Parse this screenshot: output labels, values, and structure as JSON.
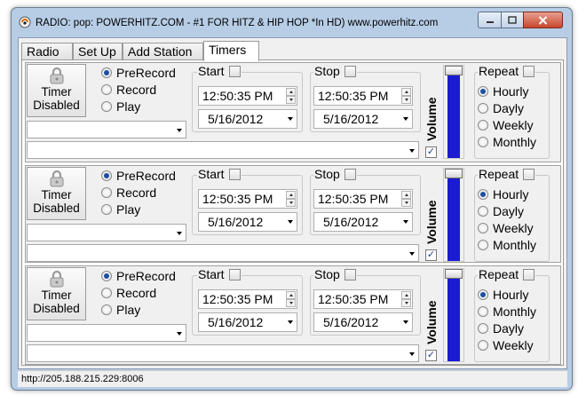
{
  "window": {
    "title": "RADIO: pop: POWERHITZ.COM - #1 FOR HITZ & HIP HOP *In HD) www.powerhitz.com",
    "app_icon": "radio-icon",
    "controls": [
      "minimize-icon",
      "maximize-icon",
      "close-icon"
    ]
  },
  "tabs": [
    {
      "label": "Radio",
      "active": false
    },
    {
      "label": "Set Up",
      "active": false
    },
    {
      "label": "Add Station",
      "active": false
    },
    {
      "label": "Timers",
      "active": true
    }
  ],
  "timers": [
    {
      "button": {
        "line1": "Timer",
        "line2": "Disabled",
        "icon": "lock-icon"
      },
      "modes": [
        "PreRecord",
        "Record",
        "Play"
      ],
      "selected_mode": "PreRecord",
      "start": {
        "label": "Start",
        "checked": false,
        "time": "12:50:35 PM",
        "date": "5/16/2012"
      },
      "stop": {
        "label": "Stop",
        "checked": false,
        "time": "12:50:35 PM",
        "date": "5/16/2012"
      },
      "volume": {
        "label": "Volume",
        "checked": true,
        "level": 0.95
      },
      "repeat": {
        "label": "Repeat",
        "checked": false,
        "options": [
          "Hourly",
          "Dayly",
          "Weekly",
          "Monthly"
        ],
        "selected": "Hourly"
      }
    },
    {
      "button": {
        "line1": "Timer",
        "line2": "Disabled",
        "icon": "lock-icon"
      },
      "modes": [
        "PreRecord",
        "Record",
        "Play"
      ],
      "selected_mode": "PreRecord",
      "start": {
        "label": "Start",
        "checked": false,
        "time": "12:50:35 PM",
        "date": "5/16/2012"
      },
      "stop": {
        "label": "Stop",
        "checked": false,
        "time": "12:50:35 PM",
        "date": "5/16/2012"
      },
      "volume": {
        "label": "Volume",
        "checked": true,
        "level": 0.95
      },
      "repeat": {
        "label": "Repeat",
        "checked": false,
        "options": [
          "Hourly",
          "Dayly",
          "Weekly",
          "Monthly"
        ],
        "selected": "Hourly"
      }
    },
    {
      "button": {
        "line1": "Timer",
        "line2": "Disabled",
        "icon": "lock-icon"
      },
      "modes": [
        "PreRecord",
        "Record",
        "Play"
      ],
      "selected_mode": "PreRecord",
      "start": {
        "label": "Start",
        "checked": false,
        "time": "12:50:35 PM",
        "date": "5/16/2012"
      },
      "stop": {
        "label": "Stop",
        "checked": false,
        "time": "12:50:35 PM",
        "date": "5/16/2012"
      },
      "volume": {
        "label": "Volume",
        "checked": true,
        "level": 0.95
      },
      "repeat": {
        "label": "Repeat",
        "checked": false,
        "options": [
          "Hourly",
          "Monthly",
          "Dayly",
          "Weekly"
        ],
        "selected": "Hourly"
      }
    }
  ],
  "status": {
    "url": "http://205.188.215.229:8006"
  },
  "colors": {
    "volume_fill": "#1b1bd2",
    "title_bar": "#b7cde6"
  }
}
